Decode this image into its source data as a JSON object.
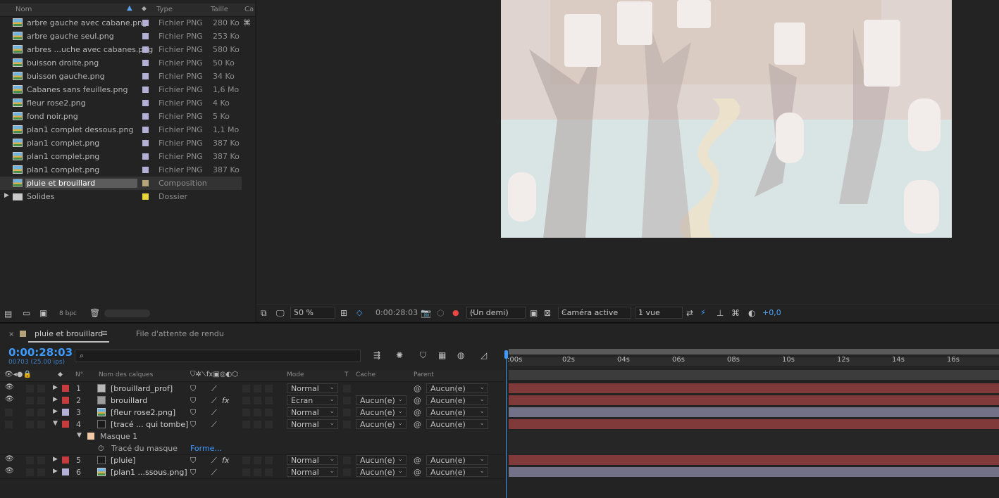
{
  "project": {
    "columns": {
      "name": "Nom",
      "type": "Type",
      "size": "Taille",
      "more": "Ca"
    },
    "items": [
      {
        "name": "arbre gauche avec cabane.png",
        "type": "Fichier PNG",
        "size": "280 Ko",
        "label_color": "#b3b0d8",
        "icon": "image-file-icon"
      },
      {
        "name": "arbre gauche seul.png",
        "type": "Fichier PNG",
        "size": "253 Ko",
        "label_color": "#b3b0d8",
        "icon": "image-file-icon"
      },
      {
        "name": "arbres ...uche avec cabanes.png",
        "type": "Fichier PNG",
        "size": "580 Ko",
        "label_color": "#b3b0d8",
        "icon": "image-file-icon"
      },
      {
        "name": "buisson droite.png",
        "type": "Fichier PNG",
        "size": "50 Ko",
        "label_color": "#b3b0d8",
        "icon": "image-file-icon"
      },
      {
        "name": "buisson gauche.png",
        "type": "Fichier PNG",
        "size": "34 Ko",
        "label_color": "#b3b0d8",
        "icon": "image-file-icon"
      },
      {
        "name": "Cabanes sans feuilles.png",
        "type": "Fichier PNG",
        "size": "1,6 Mo",
        "label_color": "#b3b0d8",
        "icon": "image-file-icon"
      },
      {
        "name": "fleur rose2.png",
        "type": "Fichier PNG",
        "size": "4 Ko",
        "label_color": "#b3b0d8",
        "icon": "image-file-icon"
      },
      {
        "name": "fond noir.png",
        "type": "Fichier PNG",
        "size": "5 Ko",
        "label_color": "#b3b0d8",
        "icon": "image-file-icon"
      },
      {
        "name": "plan1 complet dessous.png",
        "type": "Fichier PNG",
        "size": "1,1 Mo",
        "label_color": "#b3b0d8",
        "icon": "image-file-icon"
      },
      {
        "name": "plan1 complet.png",
        "type": "Fichier PNG",
        "size": "387 Ko",
        "label_color": "#b3b0d8",
        "icon": "image-file-icon"
      },
      {
        "name": "plan1 complet.png",
        "type": "Fichier PNG",
        "size": "387 Ko",
        "label_color": "#b3b0d8",
        "icon": "image-file-icon"
      },
      {
        "name": "plan1 complet.png",
        "type": "Fichier PNG",
        "size": "387 Ko",
        "label_color": "#b3b0d8",
        "icon": "image-file-icon"
      },
      {
        "name": "pluie et brouillard",
        "type": "Composition",
        "size": "",
        "label_color": "#b5a37a",
        "icon": "composition-icon",
        "selected": true
      },
      {
        "name": "Solides",
        "type": "Dossier",
        "size": "",
        "label_color": "#e8d63a",
        "icon": "folder-icon",
        "folder": true
      }
    ],
    "footer": {
      "bpc": "8 bpc"
    }
  },
  "viewer": {
    "zoom": "50 %",
    "timecode": "0:00:28:03",
    "resolution": "(Un demi)",
    "camera": "Caméra active",
    "views": "1 vue",
    "exposure": "+0,0"
  },
  "timeline": {
    "tab_active": "pluie et brouillard",
    "tab_other": "File d'attente de rendu",
    "current_time": "0:00:28:03",
    "frame_info": "00703 (25.00 ips)",
    "columns": {
      "num": "N°",
      "layer_name": "Nom des calques",
      "mode": "Mode",
      "t": "T",
      "cache": "Cache",
      "parent": "Parent"
    },
    "layers": [
      {
        "num": "1",
        "name": "[brouillard_prof]",
        "mode": "Normal",
        "cache": "",
        "parent": "Aucun(e)",
        "label": "#c63b3b",
        "swatch": "#b8b8b8",
        "visible": true,
        "fx": false,
        "bar": "#803a3a"
      },
      {
        "num": "2",
        "name": "brouillard",
        "mode": "Ecran",
        "cache": "Aucun(e)",
        "parent": "Aucun(e)",
        "label": "#c63b3b",
        "swatch": "#9d9d9d",
        "visible": true,
        "fx": true,
        "bar": "#803a3a"
      },
      {
        "num": "3",
        "name": "[fleur rose2.png]",
        "mode": "Normal",
        "cache": "Aucun(e)",
        "parent": "Aucun(e)",
        "label": "#b3b0d8",
        "swatch": "img",
        "visible": false,
        "fx": false,
        "bar": "#727187"
      },
      {
        "num": "4",
        "name": "[tracé ... qui tombe]",
        "mode": "Normal",
        "cache": "Aucun(e)",
        "parent": "Aucun(e)",
        "label": "#c63b3b",
        "swatch": "#1a1a1a",
        "visible": false,
        "fx": false,
        "bar": "#803a3a",
        "expanded": true
      },
      {
        "num": "5",
        "name": "[pluie]",
        "mode": "Normal",
        "cache": "Aucun(e)",
        "parent": "Aucun(e)",
        "label": "#c63b3b",
        "swatch": "#1a1a1a",
        "visible": true,
        "fx": true,
        "bar": "#803a3a"
      },
      {
        "num": "6",
        "name": "[plan1 ...ssous.png]",
        "mode": "Normal",
        "cache": "Aucun(e)",
        "parent": "Aucun(e)",
        "label": "#b3b0d8",
        "swatch": "img",
        "visible": true,
        "fx": false,
        "bar": "#727187"
      }
    ],
    "mask": {
      "name": "Masque 1",
      "path_label": "Tracé du masque",
      "path_value": "Forme..."
    },
    "ruler": [
      ":00s",
      "02s",
      "04s",
      "06s",
      "08s",
      "10s",
      "12s",
      "14s",
      "16s"
    ]
  }
}
